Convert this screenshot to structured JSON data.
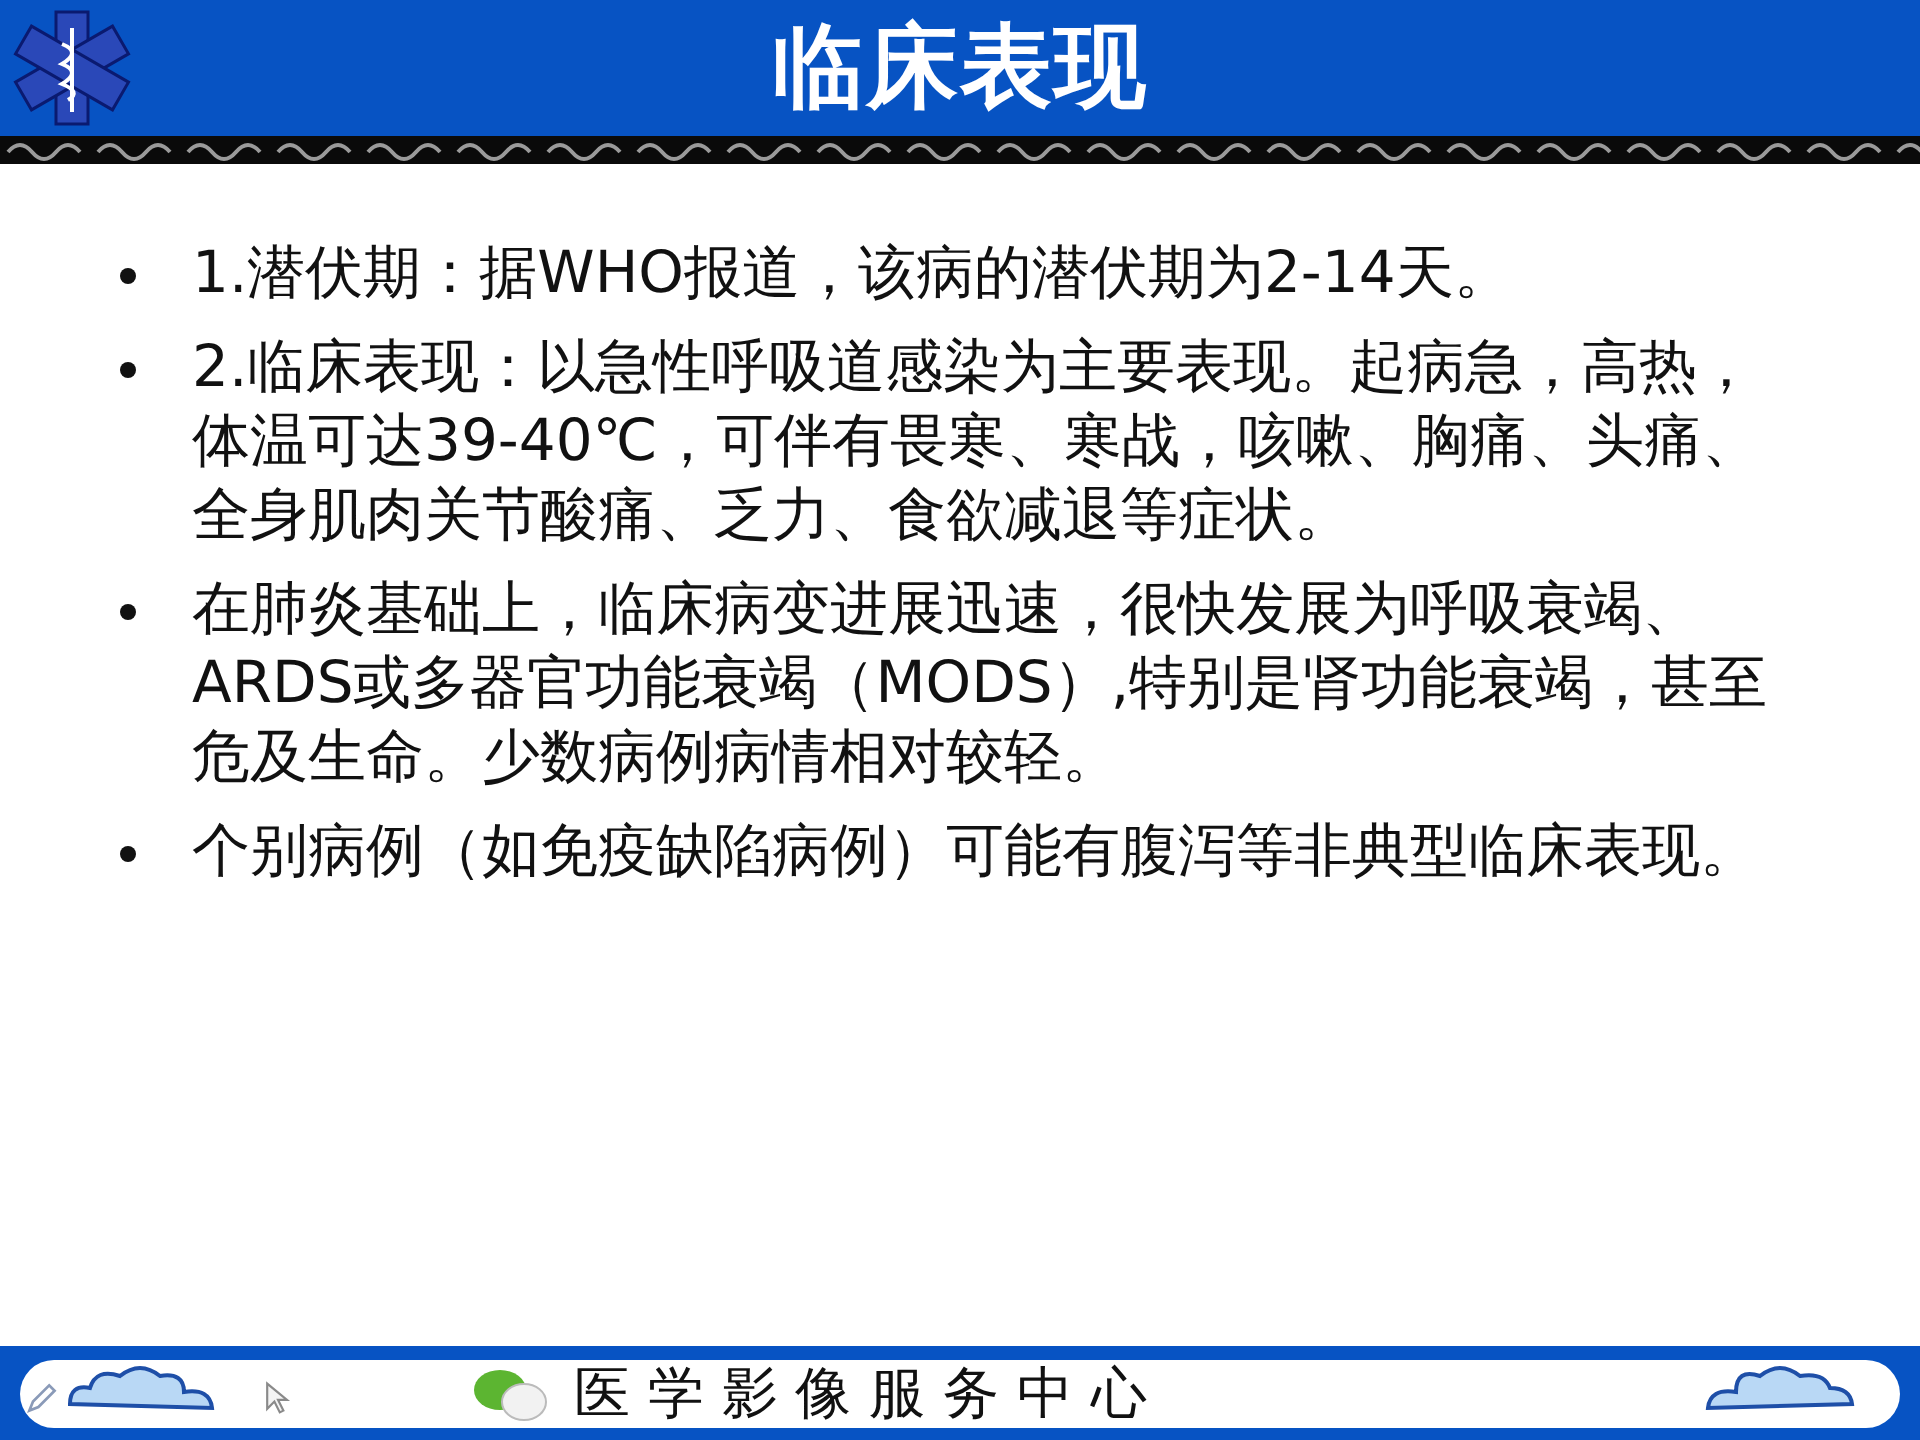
{
  "slide": {
    "title": "临床表现",
    "bullets": [
      "1.潜伏期：据WHO报道，该病的潜伏期为2-14天。",
      "2.临床表现：以急性呼吸道感染为主要表现。起病急，高热，体温可达39-40℃，可伴有畏寒、寒战，咳嗽、胸痛、头痛、全身肌肉关节酸痛、乏力、食欲减退等症状。",
      "在肺炎基础上，临床病变进展迅速，很快发展为呼吸衰竭、ARDS或多器官功能衰竭（MODS）,特别是肾功能衰竭，甚至危及生命。少数病例病情相对较轻。",
      "个别病例（如免疫缺陷病例）可能有腹泻等非典型临床表现。"
    ],
    "footer": "医 学 影 像 服 务 中 心"
  }
}
